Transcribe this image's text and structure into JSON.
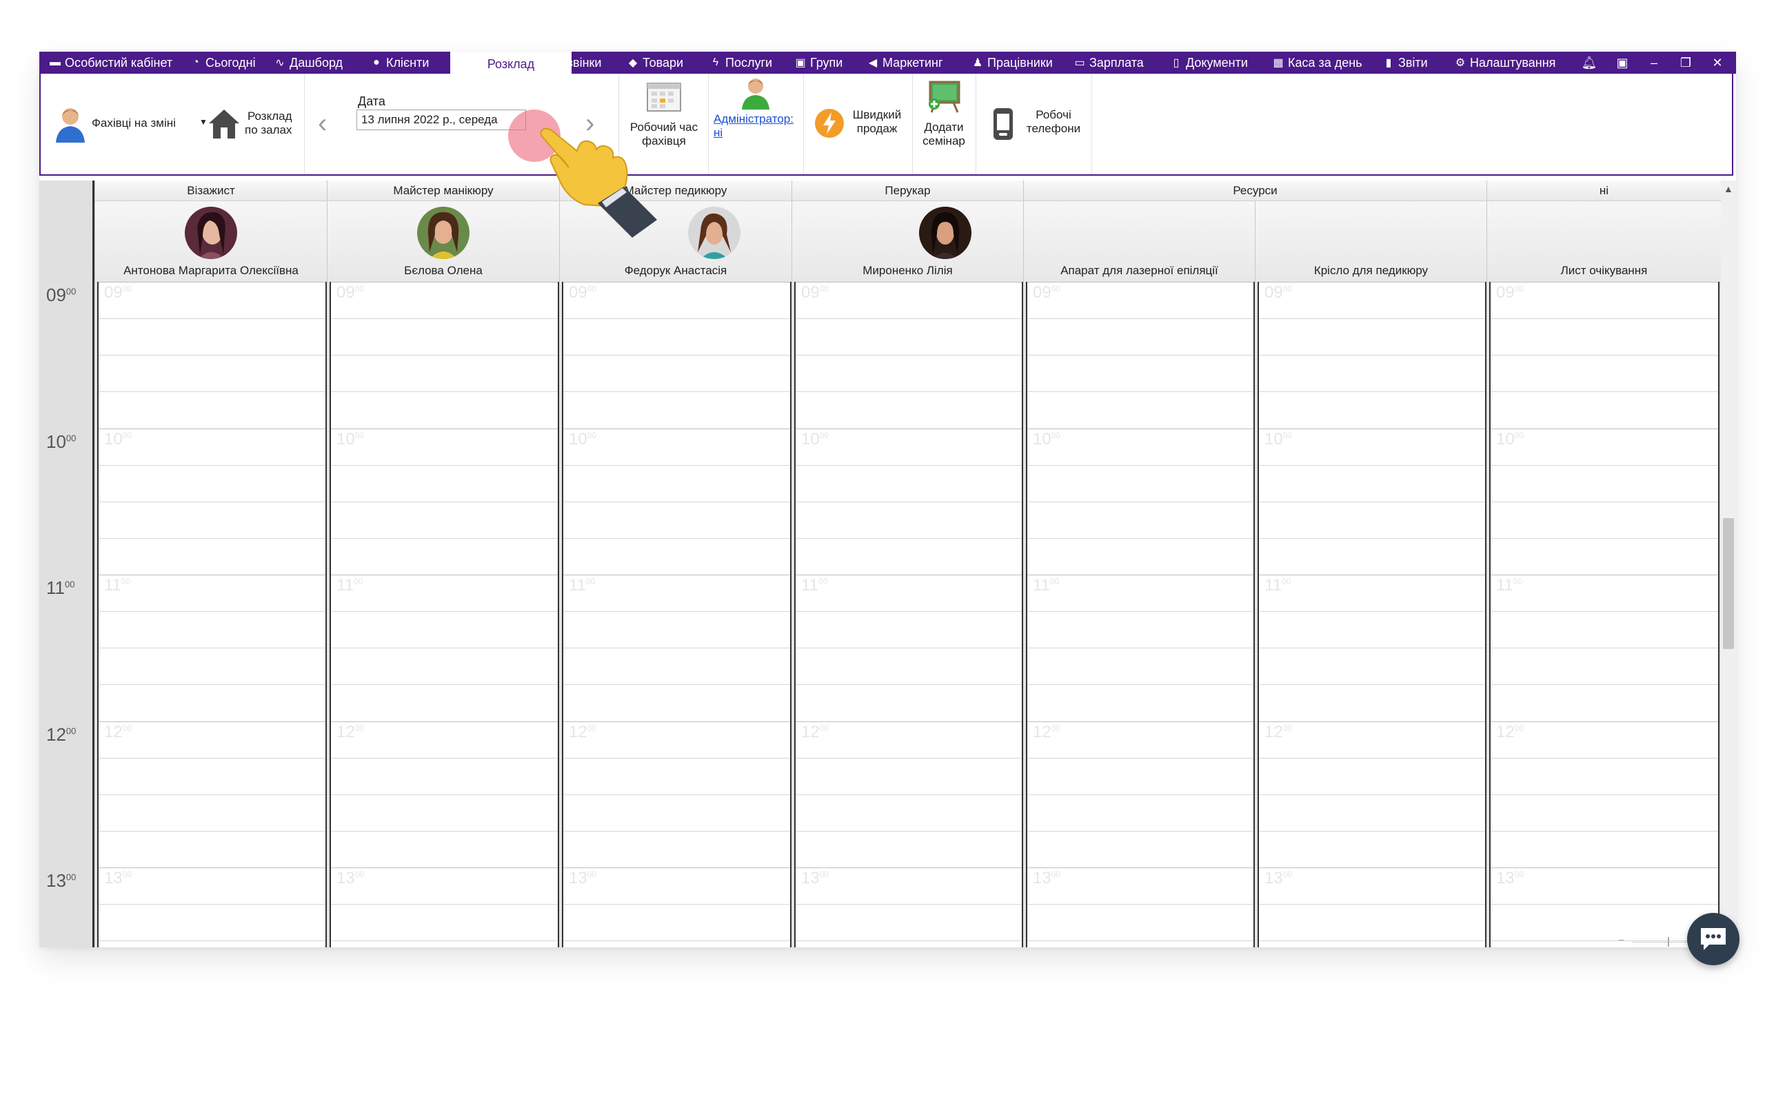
{
  "menu": {
    "items": [
      {
        "label": "Особистий кабінет",
        "icon": "briefcase-icon",
        "glyph": "▬"
      },
      {
        "label": "Сьогодні",
        "icon": "clock-icon",
        "glyph": "◔"
      },
      {
        "label": "Дашборд",
        "icon": "pulse-icon",
        "glyph": "∿"
      },
      {
        "label": "Клієнти",
        "icon": "user-circle-icon",
        "glyph": "●"
      },
      {
        "label": "Розклад",
        "icon": "",
        "glyph": ""
      },
      {
        "label": "Дзвінки",
        "icon": "phone-icon",
        "glyph": "▯"
      },
      {
        "label": "Товари",
        "icon": "box-icon",
        "glyph": "◆"
      },
      {
        "label": "Послуги",
        "icon": "bolt-icon",
        "glyph": "ϟ"
      },
      {
        "label": "Групи",
        "icon": "group-icon",
        "glyph": "▣"
      },
      {
        "label": "Маркетинг",
        "icon": "megaphone-icon",
        "glyph": "◀"
      },
      {
        "label": "Працівники",
        "icon": "person-icon",
        "glyph": "♟"
      },
      {
        "label": "Зарплата",
        "icon": "money-icon",
        "glyph": "▭"
      },
      {
        "label": "Документи",
        "icon": "document-icon",
        "glyph": "▯"
      },
      {
        "label": "Каса за день",
        "icon": "calculator-icon",
        "glyph": "▦"
      },
      {
        "label": "Звіти",
        "icon": "bar-chart-icon",
        "glyph": "▮"
      },
      {
        "label": "Налаштування",
        "icon": "gear-icon",
        "glyph": "⚙"
      }
    ],
    "active_index": 4
  },
  "toolbar": {
    "specialists_label": "Фахівці на зміні",
    "schedule_by_halls_line1": "Розклад",
    "schedule_by_halls_line2": "по залах",
    "date_label": "Дата",
    "date_value": "13 липня 2022 р., середа",
    "working_time_line1": "Робочий час",
    "working_time_line2": "фахівця",
    "admin_line1": "Адміністратор:",
    "admin_line2": "ні",
    "quick_sale_line1": "Швидкий",
    "quick_sale_line2": "продаж",
    "add_seminar_line1": "Додати",
    "add_seminar_line2": "семінар",
    "work_phones_line1": "Робочі",
    "work_phones_line2": "телефони"
  },
  "schedule": {
    "categories": [
      "Візажист",
      "Майстер манікюру",
      "Майстер педикюру",
      "Перукар",
      "Ресурси",
      "ні"
    ],
    "resources": [
      {
        "name": "Антонова Маргарита Олексіївна",
        "has_avatar": true
      },
      {
        "name": "Бєлова Олена",
        "has_avatar": true
      },
      {
        "name": "Федорук Анастасія",
        "has_avatar": true
      },
      {
        "name": "Мироненко Лілія",
        "has_avatar": true
      },
      {
        "name": "Апарат для лазерної епіляції",
        "has_avatar": false
      },
      {
        "name": "Крісло для педикюру",
        "has_avatar": false
      },
      {
        "name": "Лист очікування",
        "has_avatar": false
      }
    ],
    "hours": [
      "09",
      "10",
      "11",
      "12",
      "13"
    ],
    "minutes": "00"
  }
}
